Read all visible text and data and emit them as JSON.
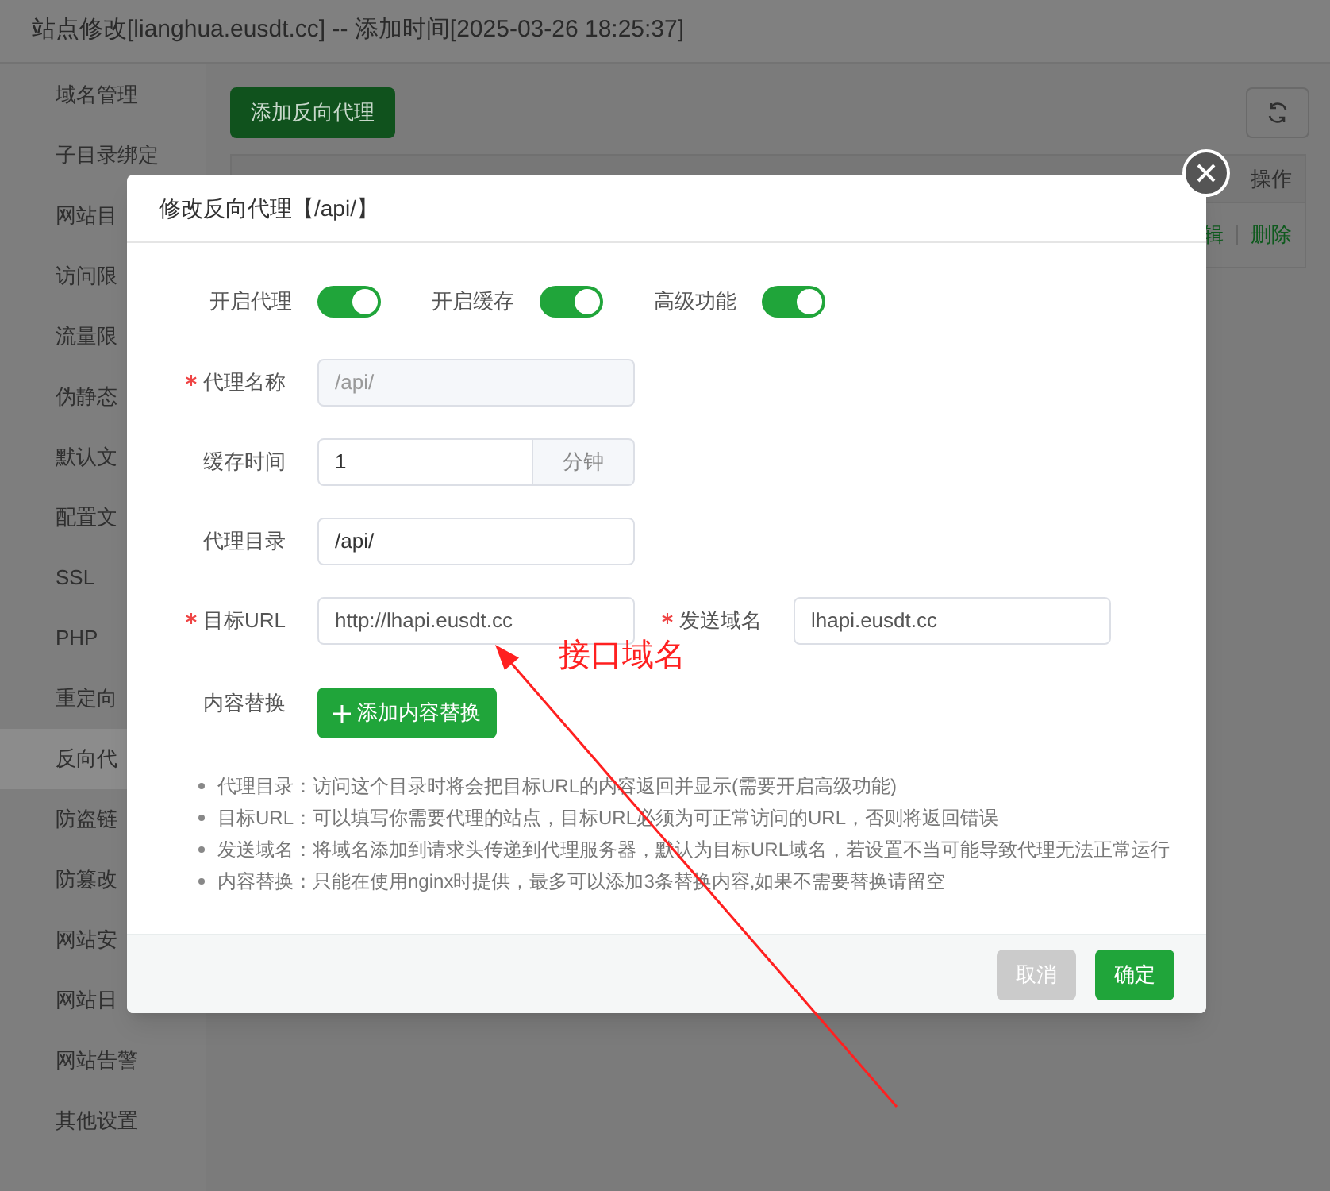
{
  "window": {
    "title": "站点修改[lianghua.eusdt.cc] -- 添加时间[2025-03-26 18:25:37]"
  },
  "sidebar": {
    "items": [
      {
        "label": "域名管理",
        "selected": false
      },
      {
        "label": "子目录绑定",
        "selected": false
      },
      {
        "label": "网站目",
        "selected": false
      },
      {
        "label": "访问限",
        "selected": false
      },
      {
        "label": "流量限",
        "selected": false
      },
      {
        "label": "伪静态",
        "selected": false
      },
      {
        "label": "默认文",
        "selected": false
      },
      {
        "label": "配置文",
        "selected": false
      },
      {
        "label": "SSL",
        "selected": false
      },
      {
        "label": "PHP",
        "selected": false
      },
      {
        "label": "重定向",
        "selected": false
      },
      {
        "label": "反向代",
        "selected": true
      },
      {
        "label": "防盗链",
        "selected": false
      },
      {
        "label": "防篡改",
        "selected": false
      },
      {
        "label": "网站安",
        "selected": false
      },
      {
        "label": "网站日",
        "selected": false
      },
      {
        "label": "网站告警",
        "selected": false
      },
      {
        "label": "其他设置",
        "selected": false
      }
    ]
  },
  "toolbar": {
    "add_button": "添加反向代理"
  },
  "table": {
    "columns": [
      {
        "label": "操作"
      }
    ],
    "row_actions": [
      "辑",
      "删除"
    ]
  },
  "dialog": {
    "title": "修改反向代理【/api/】",
    "toggles": [
      {
        "label": "开启代理",
        "on": true
      },
      {
        "label": "开启缓存",
        "on": true
      },
      {
        "label": "高级功能",
        "on": true
      }
    ],
    "fields": [
      {
        "kind": "text",
        "label": "代理名称",
        "required": true,
        "disabled": true,
        "value": "/api/"
      },
      {
        "kind": "unit",
        "label": "缓存时间",
        "required": false,
        "value": "1",
        "unit": "分钟"
      },
      {
        "kind": "text",
        "label": "代理目录",
        "required": false,
        "disabled": false,
        "value": "/api/"
      },
      {
        "kind": "pair",
        "label": "目标URL",
        "required": true,
        "value": "http://lhapi.eusdt.cc",
        "second_label": "发送域名",
        "second_required": true,
        "second_value": "lhapi.eusdt.cc"
      },
      {
        "kind": "button",
        "label": "内容替换",
        "button": "添加内容替换"
      }
    ],
    "notes": [
      "代理目录：访问这个目录时将会把目标URL的内容返回并显示(需要开启高级功能)",
      "目标URL：可以填写你需要代理的站点，目标URL必须为可正常访问的URL，否则将返回错误",
      "发送域名：将域名添加到请求头传递到代理服务器，默认为目标URL域名，若设置不当可能导致代理无法正常运行",
      "内容替换：只能在使用nginx时提供，最多可以添加3条替换内容,如果不需要替换请留空"
    ],
    "buttons": [
      {
        "label": "取消",
        "kind": "secondary"
      },
      {
        "label": "确定",
        "kind": "primary"
      }
    ]
  },
  "annotation": {
    "text": "接口域名"
  }
}
